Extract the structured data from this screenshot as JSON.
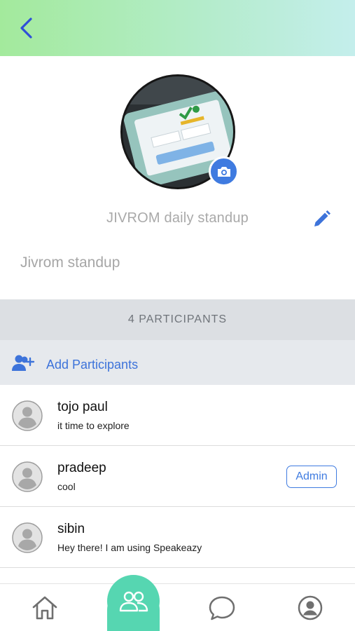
{
  "header": {
    "back_icon": "chevron-left-icon"
  },
  "group": {
    "name": "JIVROM daily standup",
    "description": "Jivrom standup",
    "photo_icon": "camera-icon",
    "edit_icon": "pencil-icon"
  },
  "participants": {
    "count_label": "4 PARTICIPANTS",
    "add_label": "Add Participants",
    "items": [
      {
        "name": "tojo paul",
        "status": "it time to explore",
        "admin": false
      },
      {
        "name": "pradeep",
        "status": "cool",
        "admin": true,
        "badge": "Admin"
      },
      {
        "name": "sibin",
        "status": "Hey there! I am using Speakeazy",
        "admin": false
      }
    ]
  },
  "tabbar": {
    "items": [
      "home-icon",
      "groups-icon",
      "chat-icon",
      "profile-icon"
    ],
    "active": "groups-icon"
  },
  "colors": {
    "accent_blue": "#3f7be0",
    "tab_active": "#56d6b1",
    "header_gradient_start": "#a3ea9c",
    "header_gradient_end": "#c4eeec"
  }
}
